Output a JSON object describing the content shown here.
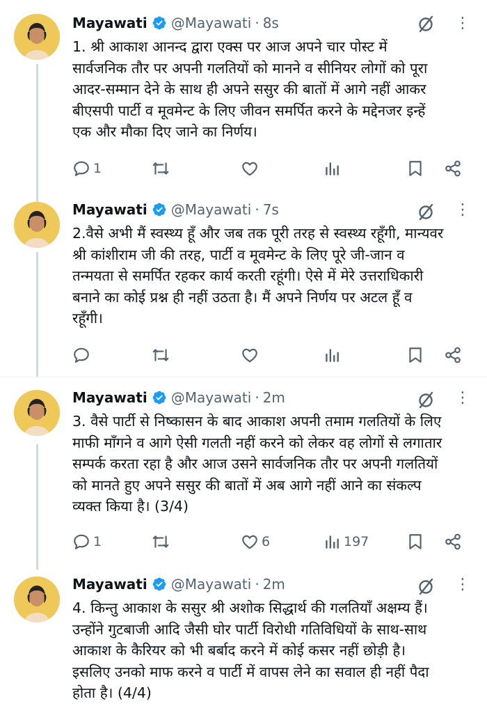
{
  "tweets": [
    {
      "name": "Mayawati",
      "handle": "@Mayawati",
      "separator": "·",
      "time": "8s",
      "text": "1. श्री आकाश आनन्द द्वारा एक्स पर आज अपने चार पोस्ट में\nसार्वजनिक तौर पर अपनी गलतियों को मानने व सीनियर लोगों को पूरा\nआदर-सम्मान देने के साथ ही अपने ससुर की बातों में आगे नहीं आकर\nबीएसपी पार्टी व मूवमेन्ट के लिए जीवन समर्पित करने के मद्देनजर इन्हें\nएक और मौका दिए जाने का निर्णय।",
      "replies": "1",
      "reposts": "",
      "likes": "",
      "views": ""
    },
    {
      "name": "Mayawati",
      "handle": "@Mayawati",
      "separator": "·",
      "time": "7s",
      "text": "2.वैसे अभी मैं स्वस्थ्य हूँ और जब तक पूरी तरह से स्वस्थ्य रहूँगी, मान्यवर\nश्री कांशीराम जी की तरह, पार्टी व मूवमेन्ट के लिए पूरे जी-जान व\nतन्मयता से समर्पित रहकर कार्य करती रहूंगी। ऐसे में मेरे उत्तराधिकारी\nबनाने का कोई प्रश्न ही नहीं उठता है। मैं अपने निर्णय पर अटल हूँ व\nरहूँगी।",
      "replies": "",
      "reposts": "",
      "likes": "",
      "views": ""
    },
    {
      "name": "Mayawati",
      "handle": "@Mayawati",
      "separator": "·",
      "time": "2m",
      "text": "3. वैसे पार्टी से निष्कासन के बाद आकाश अपनी तमाम गलतियों के लिए\nमाफी माँगने व आगे ऐसी गलती नहीं करने को लेकर वह लोगों से लगातार\nसम्पर्क करता रहा है और आज उसने सार्वजनिक तौर पर अपनी गलतियों\nको मानते हुए अपने ससुर की बातों में अब आगे नहीं आने का संकल्प\nव्यक्त किया है। (3/4)",
      "replies": "1",
      "reposts": "",
      "likes": "6",
      "views": "197"
    },
    {
      "name": "Mayawati",
      "handle": "@Mayawati",
      "separator": "·",
      "time": "2m",
      "text": "4. किन्तु आकाश के ससुर श्री अशोक सिद्धार्थ की गलतियाँ अक्षम्य हैं।\nउन्होंने गुटबाजी आदि जैसी घोर पार्टी विरोधी गतिविधियों के साथ-साथ\nआकाश के कैरियर को भी बर्बाद करने में कोई कसर नहीं छोड़ी है।\nइसलिए उनको माफ करने व पार्टी में वापस लेने का सवाल ही नहीं पैदा\nहोता है। (4/4)"
    }
  ],
  "icons": {
    "verified": "verified-badge-icon",
    "grok": "grok-icon",
    "more": "more-options-icon",
    "reply": "reply-icon",
    "repost": "repost-icon",
    "like": "like-icon",
    "views": "views-icon",
    "bookmark": "bookmark-icon",
    "share": "share-icon"
  },
  "colors": {
    "verified": "#1d9bf0",
    "text": "#0f1419",
    "muted": "#536471",
    "divider": "#eff3f4"
  }
}
